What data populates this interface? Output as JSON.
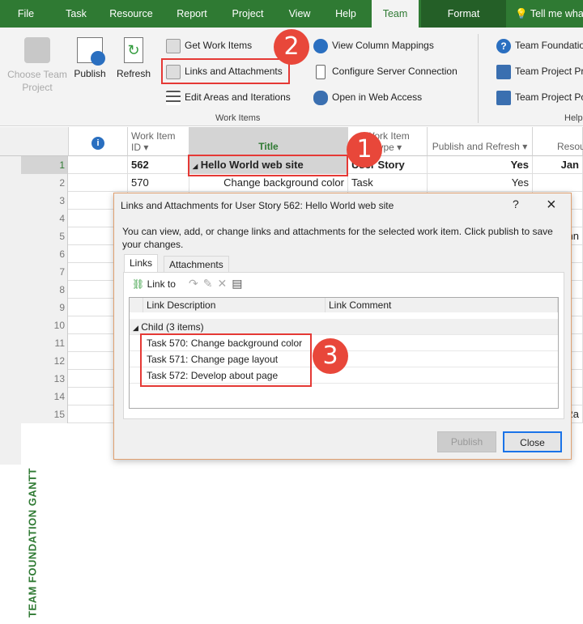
{
  "tabs": [
    "File",
    "Task",
    "Resource",
    "Report",
    "Project",
    "View",
    "Help",
    "Team",
    "Format",
    "Tell me what"
  ],
  "ribbon": {
    "choose_team_project": "Choose Team Project",
    "publish": "Publish",
    "refresh": "Refresh",
    "get_work_items": "Get Work Items",
    "links_and_attachments": "Links and Attachments",
    "edit_areas": "Edit Areas and Iterations",
    "view_column_mappings": "View Column Mappings",
    "configure_server": "Configure Server Connection",
    "open_web_access": "Open in Web Access",
    "team_foundation_help": "Team Foundation",
    "team_project_pr": "Team Project Pr",
    "team_project_po": "Team Project Po",
    "group_work_items": "Work Items",
    "group_help": "Help"
  },
  "callouts": [
    "1",
    "2",
    "3"
  ],
  "grid": {
    "headers": {
      "info": "i",
      "id": "Work Item ID",
      "title": "Title",
      "type": "Work Item Type",
      "publish": "Publish and Refresh",
      "resource": "Resou"
    },
    "rows": [
      {
        "n": "1",
        "id": "562",
        "title": "Hello World web site",
        "type": "User Story",
        "publish": "Yes",
        "resource": "Jan"
      },
      {
        "n": "2",
        "id": "570",
        "title": "Change background color",
        "type": "Task",
        "publish": "Yes",
        "resource": ""
      },
      {
        "n": "3"
      },
      {
        "n": "4"
      },
      {
        "n": "5",
        "resource": "hn"
      },
      {
        "n": "6"
      },
      {
        "n": "7"
      },
      {
        "n": "8"
      },
      {
        "n": "9"
      },
      {
        "n": "10"
      },
      {
        "n": "11"
      },
      {
        "n": "12"
      },
      {
        "n": "13"
      },
      {
        "n": "14"
      },
      {
        "n": "15",
        "resource": "Ra"
      }
    ],
    "side_label": "TEAM FOUNDATION GANTT"
  },
  "dialog": {
    "title": "Links and Attachments for User Story 562: Hello World web site",
    "help": "?",
    "close_icon": "×",
    "description": "You can view, add, or change links and attachments for the selected work item. Click publish to save your changes.",
    "tabs": [
      "Links",
      "Attachments"
    ],
    "link_to": "Link to",
    "columns": [
      "Link Description",
      "Link Comment"
    ],
    "group": "Child (3 items)",
    "items": [
      "Task 570: Change background color",
      "Task 571: Change page layout",
      "Task 572: Develop about page"
    ],
    "publish": "Publish",
    "close": "Close"
  },
  "colors": {
    "brand": "#2f7a33",
    "callout": "#e8473a",
    "highlight": "#e53935"
  }
}
